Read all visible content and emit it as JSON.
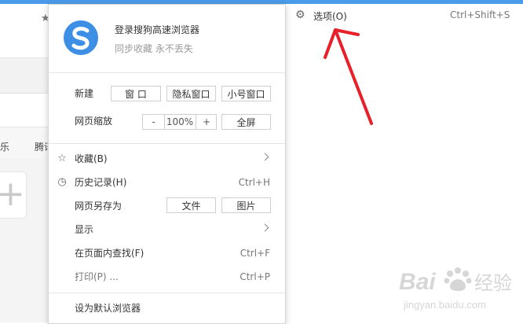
{
  "menu": {
    "login_title": "登录搜狗高速浏览器",
    "login_subtitle": "同步收藏 永不丢失",
    "new": {
      "label": "新建",
      "window": "窗 口",
      "private_window": "隐私窗口",
      "mini_window": "小号窗口"
    },
    "zoom": {
      "label": "网页缩放",
      "minus": "-",
      "value": "100%",
      "plus": "+",
      "fullscreen": "全屏"
    },
    "favorites": "收藏(B)",
    "history": {
      "label": "历史记录(H)",
      "shortcut": "Ctrl+H"
    },
    "save_as": {
      "label": "网页另存为",
      "file": "文件",
      "image": "图片"
    },
    "display": "显示",
    "find": {
      "label": "在页面内查找(F)",
      "shortcut": "Ctrl+F"
    },
    "print": {
      "label": "打印(P) ...",
      "shortcut": "Ctrl+P"
    },
    "set_default": "设为默认浏览器"
  },
  "options": {
    "label": "选项(O)",
    "shortcut": "Ctrl+Shift+S"
  },
  "background": {
    "nav_partial_1": "乐",
    "nav_partial_2": "腾讯"
  },
  "watermark": {
    "brand": "Bai",
    "brand2": "经验",
    "url": "jingyan.baidu.com"
  },
  "colors": {
    "accent": "#4a9bea",
    "annotation_arrow": "#e8202a",
    "logo": "#3d8fe6"
  },
  "icons": {
    "star": "star-icon",
    "history": "clock-icon",
    "options": "gear-icon"
  }
}
